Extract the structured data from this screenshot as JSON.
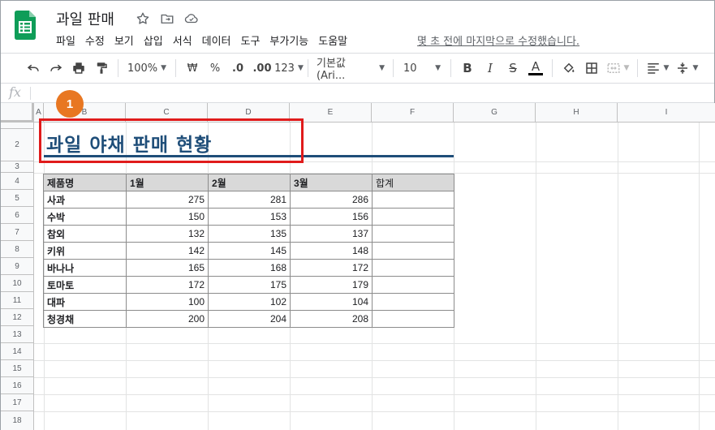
{
  "doc": {
    "title": "과일 판매",
    "last_edit": "몇 초 전에 마지막으로 수정했습니다."
  },
  "menu": [
    "파일",
    "수정",
    "보기",
    "삽입",
    "서식",
    "데이터",
    "도구",
    "부가기능",
    "도움말"
  ],
  "toolbar": {
    "zoom": "100%",
    "currency": "₩",
    "percent": "%",
    "dec_decrease": ".0",
    "dec_increase": ".00",
    "format_more": "123",
    "font": "기본값 (Ari...",
    "font_size": "10",
    "bold": "B",
    "italic": "I",
    "strike": "S",
    "text_color": "A"
  },
  "formula_bar": {
    "fx": "fx"
  },
  "columns": [
    "A",
    "B",
    "C",
    "D",
    "E",
    "F",
    "G",
    "H",
    "I"
  ],
  "rows": [
    "2",
    "3",
    "4",
    "5",
    "6",
    "7",
    "8",
    "9",
    "10",
    "11",
    "12",
    "13",
    "14",
    "15",
    "16",
    "17",
    "18"
  ],
  "badge": "1",
  "sheet_title": "과일 야채 판매 현황",
  "table": {
    "headers": [
      "제품명",
      "1월",
      "2월",
      "3월",
      "합계"
    ],
    "rows": [
      [
        "사과",
        "275",
        "281",
        "286",
        ""
      ],
      [
        "수박",
        "150",
        "153",
        "156",
        ""
      ],
      [
        "참외",
        "132",
        "135",
        "137",
        ""
      ],
      [
        "키위",
        "142",
        "145",
        "148",
        ""
      ],
      [
        "바나나",
        "165",
        "168",
        "172",
        ""
      ],
      [
        "토마토",
        "172",
        "175",
        "179",
        ""
      ],
      [
        "대파",
        "100",
        "102",
        "104",
        ""
      ],
      [
        "청경채",
        "200",
        "204",
        "208",
        ""
      ]
    ]
  }
}
